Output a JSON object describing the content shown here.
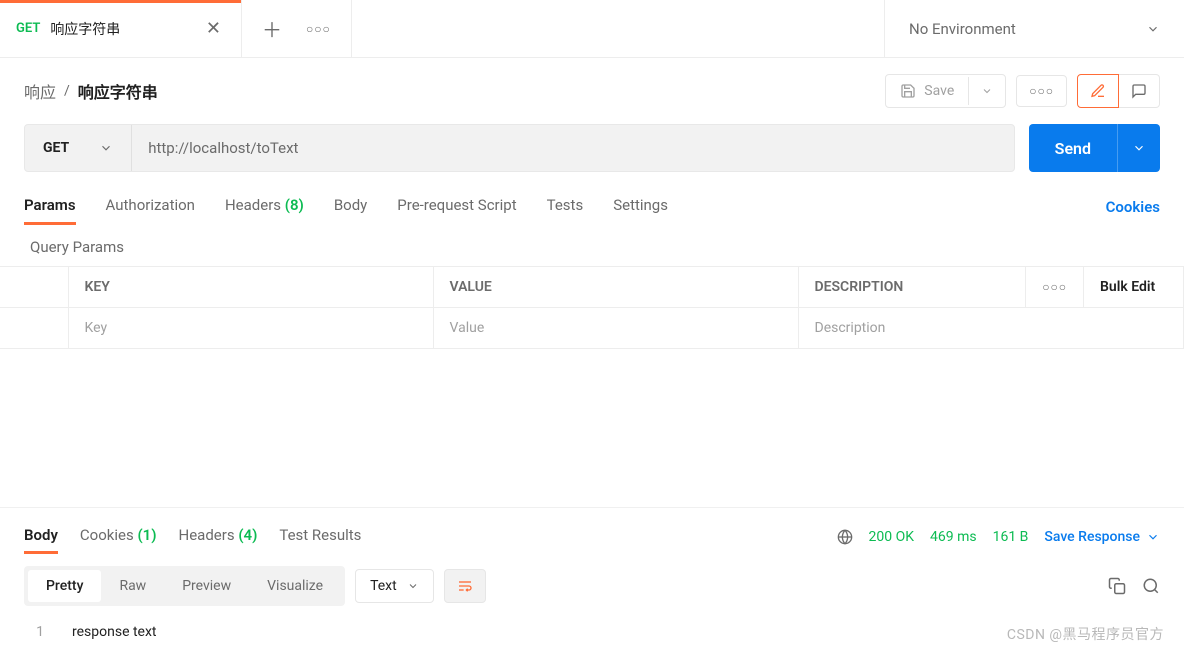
{
  "header": {
    "tab_method": "GET",
    "tab_name": "响应字符串",
    "env_label": "No Environment"
  },
  "breadcrumb": {
    "parent": "响应",
    "sep": "/",
    "current": "响应字符串",
    "save_label": "Save"
  },
  "request": {
    "method": "GET",
    "url": "http://localhost/toText",
    "send_label": "Send",
    "tabs": {
      "params": "Params",
      "auth": "Authorization",
      "headers": "Headers",
      "headers_count": "(8)",
      "body": "Body",
      "prereq": "Pre-request Script",
      "tests": "Tests",
      "settings": "Settings",
      "cookies": "Cookies"
    },
    "query_title": "Query Params",
    "table": {
      "key_h": "KEY",
      "val_h": "VALUE",
      "desc_h": "DESCRIPTION",
      "bulk": "Bulk Edit",
      "key_ph": "Key",
      "val_ph": "Value",
      "desc_ph": "Description"
    }
  },
  "response": {
    "tabs": {
      "body": "Body",
      "cookies": "Cookies",
      "cookies_count": "(1)",
      "headers": "Headers",
      "headers_count": "(4)",
      "tests": "Test Results"
    },
    "status_code": "200 OK",
    "time": "469 ms",
    "size": "161 B",
    "save_label": "Save Response",
    "views": {
      "pretty": "Pretty",
      "raw": "Raw",
      "preview": "Preview",
      "visualize": "Visualize"
    },
    "format": "Text",
    "body_line_no": "1",
    "body_text": "response text"
  },
  "watermark": "CSDN @黑马程序员官方"
}
